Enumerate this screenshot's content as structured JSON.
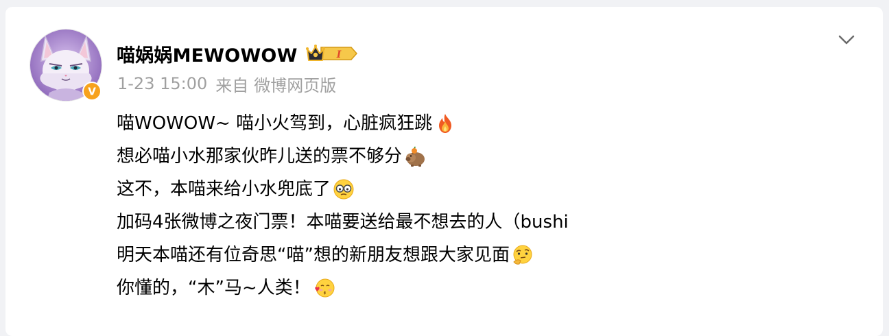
{
  "post": {
    "author": {
      "name": "喵娲娲MEWOWOW",
      "avatar_icon": "cat-avatar",
      "verified_badge_letter": "V",
      "vip_badge_label": "I",
      "colors": {
        "verified": "#f7a21d",
        "vip": "#f0b52b"
      }
    },
    "meta": {
      "time": "1-23 15:00",
      "source_prefix": "来自",
      "source_client": "微博网页版"
    },
    "menu_icon": "chevron-down-icon",
    "lines": [
      {
        "text": "喵WOWOW~ 喵小火驾到，心脏疯狂跳",
        "emoji": "fire-emoji"
      },
      {
        "text": "想必喵小水那家伙昨儿送的票不够分",
        "emoji": "capybara-emoji"
      },
      {
        "text": "这不，本喵来给小水兜底了",
        "emoji": "glasses-face-emoji"
      },
      {
        "text": "加码4张微博之夜门票！本喵要送给最不想去的人（bushi",
        "emoji": ""
      },
      {
        "text": "明天本喵还有位奇思“喵”想的新朋友想跟大家见面",
        "emoji": "thinking-face-emoji"
      },
      {
        "text": "你懂的，“木”马~人类！",
        "emoji": "kissing-face-emoji"
      }
    ]
  }
}
